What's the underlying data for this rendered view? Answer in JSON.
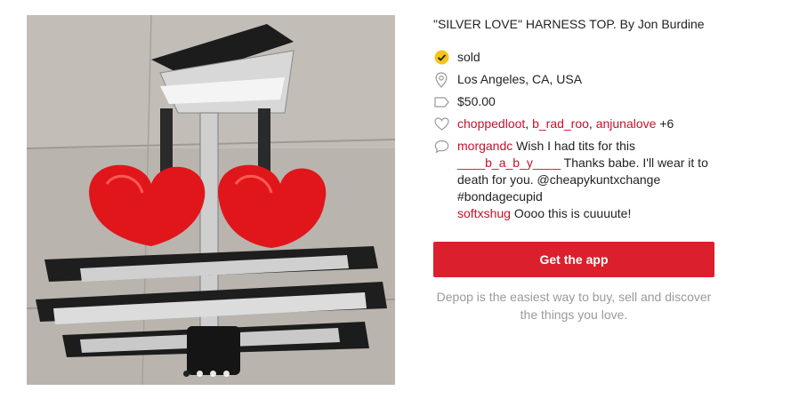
{
  "listing": {
    "title": "\"SILVER LOVE\" HARNESS TOP. By Jon Burdine",
    "status": "sold",
    "location": "Los Angeles, CA, USA",
    "price": "$50.00",
    "likes": {
      "users": [
        "choppedloot",
        "b_rad_roo",
        "anjunalove"
      ],
      "more": "+6"
    },
    "comments": [
      {
        "user": "morgandc",
        "text": " Wish I had tits for this"
      },
      {
        "user": "____b_a_b_y____",
        "text": " Thanks babe. I'll wear it to death for you. @cheapykuntxchange #bondagecupid"
      },
      {
        "user": "softxshug",
        "text": " Oooo this is cuuuute!"
      }
    ]
  },
  "cta": {
    "label": "Get the app"
  },
  "tagline": "Depop is the easiest way to buy, sell and discover the things you love.",
  "gallery": {
    "count": 4,
    "active_index": 0
  },
  "icons": {
    "status": "check-circle-icon",
    "location": "location-pin-icon",
    "price": "price-tag-icon",
    "likes": "heart-icon",
    "comments": "speech-bubble-icon"
  },
  "colors": {
    "accent": "#db1f2c",
    "link": "#c8102e",
    "sold_badge": "#f5c518"
  }
}
